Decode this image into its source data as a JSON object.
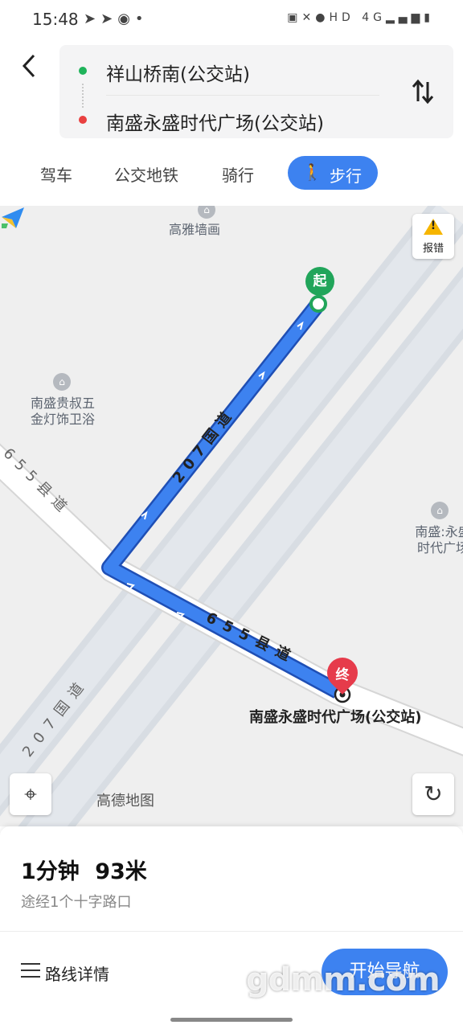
{
  "status_bar": {
    "time": "15:48",
    "left_icons": [
      "telegram-icon",
      "telegram-icon",
      "app-icon",
      "dot-icon"
    ],
    "right_text": "HD 4G",
    "right_icons": [
      "nfc-icon",
      "mute-icon",
      "location-icon",
      "signal-icon",
      "battery-icon"
    ]
  },
  "header": {
    "start_place": "祥山桥南(公交站)",
    "end_place": "南盛永盛时代广场(公交站)",
    "modes": [
      {
        "label": "驾车",
        "active": false
      },
      {
        "label": "公交地铁",
        "active": false
      },
      {
        "label": "骑行",
        "active": false
      },
      {
        "label": "步行",
        "active": true
      }
    ]
  },
  "map": {
    "pois": [
      {
        "label": "高雅墙画"
      },
      {
        "label": "南盛贵叔五\n金灯饰卫浴"
      },
      {
        "label": "南盛:永盛\n时代广场"
      }
    ],
    "roads": {
      "national_207_route": "207国道",
      "county_655_route": "655县道",
      "national_207_main": "207国道",
      "county_655_main": "655县道"
    },
    "report_label": "报错",
    "start_marker": "起",
    "end_marker": "终",
    "destination_label": "南盛永盛时代广场(公交站)",
    "brand": "高德地图",
    "colors": {
      "route": "#3d82f0",
      "start": "#21a55a",
      "end": "#e63b4b"
    }
  },
  "summary": {
    "duration": "1分钟",
    "distance": "93米",
    "via": "途经1个十字路口",
    "details_label": "路线详情",
    "start_nav_label": "开始导航"
  },
  "watermark": "gdmm.com"
}
